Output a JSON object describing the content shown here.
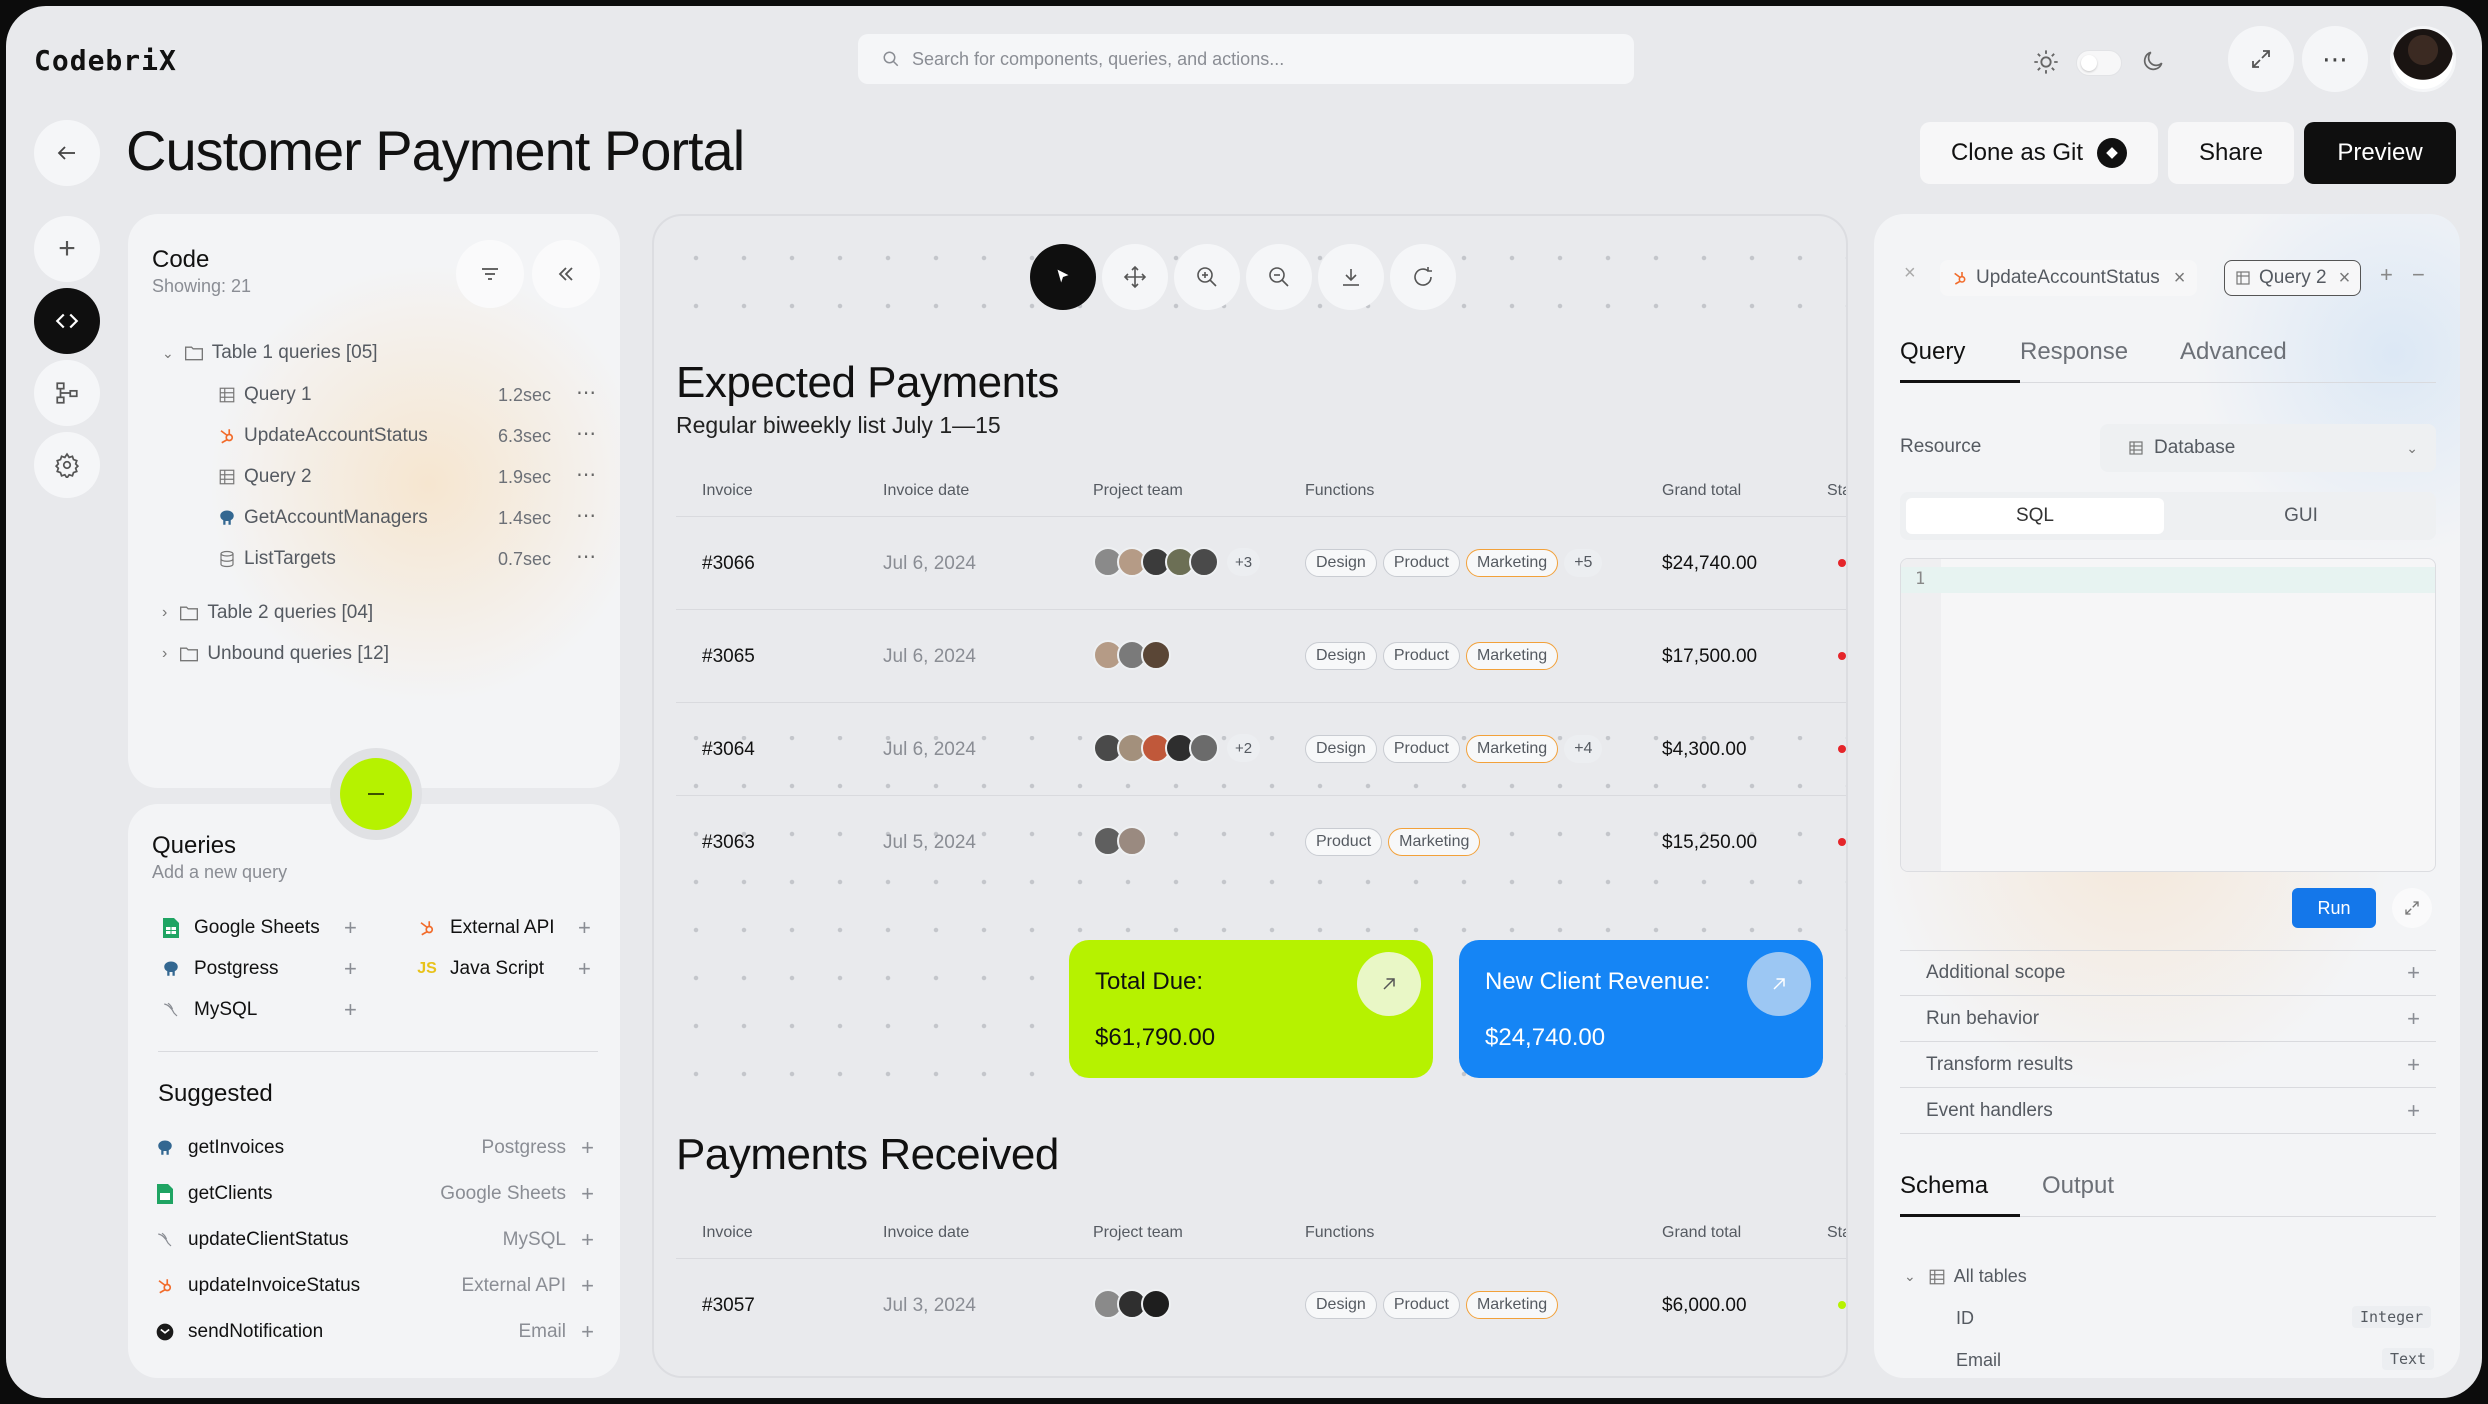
{
  "app": {
    "logo": "CodebriX"
  },
  "search": {
    "placeholder": "Search for components, queries, and actions..."
  },
  "page": {
    "title": "Customer Payment Portal"
  },
  "header_buttons": {
    "clone": "Clone as Git",
    "share": "Share",
    "preview": "Preview"
  },
  "code_panel": {
    "title": "Code",
    "subtitle": "Showing: 21",
    "groups": [
      {
        "label": "Table 1 queries [05]",
        "items": [
          {
            "name": "Query 1",
            "time": "1.2sec",
            "icon": "table-icon"
          },
          {
            "name": "UpdateAccountStatus",
            "time": "6.3sec",
            "icon": "hubspot-icon"
          },
          {
            "name": "Query 2",
            "time": "1.9sec",
            "icon": "table-icon"
          },
          {
            "name": "GetAccountManagers",
            "time": "1.4sec",
            "icon": "postgres-icon"
          },
          {
            "name": "ListTargets",
            "time": "0.7sec",
            "icon": "database-icon"
          }
        ]
      },
      {
        "label": "Table 2 queries [04]"
      },
      {
        "label": "Unbound queries [12]"
      }
    ]
  },
  "queries_panel": {
    "title": "Queries",
    "subtitle": "Add a new query",
    "sources": [
      {
        "name": "Google Sheets",
        "icon": "google-sheets-icon"
      },
      {
        "name": "External API",
        "icon": "hubspot-icon"
      },
      {
        "name": "Postgress",
        "icon": "postgres-icon"
      },
      {
        "name": "Java Script",
        "icon": "javascript-icon"
      },
      {
        "name": "MySQL",
        "icon": "mysql-icon"
      }
    ],
    "suggested_title": "Suggested",
    "suggested": [
      {
        "name": "getInvoices",
        "source": "Postgress",
        "icon": "postgres-icon"
      },
      {
        "name": "getClients",
        "source": "Google Sheets",
        "icon": "google-sheets-icon"
      },
      {
        "name": "updateClientStatus",
        "source": "MySQL",
        "icon": "mysql-icon"
      },
      {
        "name": "updateInvoiceStatus",
        "source": "External API",
        "icon": "hubspot-icon"
      },
      {
        "name": "sendNotification",
        "source": "Email",
        "icon": "email-icon"
      }
    ]
  },
  "canvas": {
    "expected": {
      "title": "Expected Payments",
      "subtitle": "Regular biweekly list July 1—15",
      "columns": [
        "Invoice",
        "Invoice date",
        "Project team",
        "Functions",
        "Grand total",
        "Sta"
      ],
      "rows": [
        {
          "invoice": "#3066",
          "date": "Jul 6, 2024",
          "team": 5,
          "team_more": "+3",
          "tags": [
            "Design",
            "Product",
            "Marketing"
          ],
          "tags_more": "+5",
          "total": "$24,740.00",
          "status_color": "#e5252a"
        },
        {
          "invoice": "#3065",
          "date": "Jul 6, 2024",
          "team": 3,
          "team_more": "",
          "tags": [
            "Design",
            "Product",
            "Marketing"
          ],
          "tags_more": "",
          "total": "$17,500.00",
          "status_color": "#e5252a"
        },
        {
          "invoice": "#3064",
          "date": "Jul 6, 2024",
          "team": 5,
          "team_more": "+2",
          "tags": [
            "Design",
            "Product",
            "Marketing"
          ],
          "tags_more": "+4",
          "total": "$4,300.00",
          "status_color": "#e5252a"
        },
        {
          "invoice": "#3063",
          "date": "Jul 5, 2024",
          "team": 2,
          "team_more": "",
          "tags": [
            "Product",
            "Marketing"
          ],
          "tags_more": "",
          "total": "$15,250.00",
          "status_color": "#e5252a"
        }
      ]
    },
    "cards": [
      {
        "label": "Total Due:",
        "value": "$61,790.00",
        "color": "#b6f200"
      },
      {
        "label": "New Client Revenue:",
        "value": "$24,740.00",
        "color": "#1585f5"
      }
    ],
    "received": {
      "title": "Payments Received",
      "columns": [
        "Invoice",
        "Invoice date",
        "Project team",
        "Functions",
        "Grand total",
        "Sta"
      ],
      "rows": [
        {
          "invoice": "#3057",
          "date": "Jul 3, 2024",
          "team": 3,
          "team_more": "",
          "tags": [
            "Design",
            "Product",
            "Marketing"
          ],
          "tags_more": "",
          "total": "$6,000.00",
          "status_color": "#b6f200"
        }
      ]
    }
  },
  "right_panel": {
    "open_tabs": [
      "UpdateAccountStatus",
      "Query 2"
    ],
    "tabs": [
      "Query",
      "Response",
      "Advanced"
    ],
    "active_tab": "Query",
    "resource_label": "Resource",
    "resource_value": "Database",
    "mode": [
      "SQL",
      "GUI"
    ],
    "line_number": "1",
    "run": "Run",
    "sections": [
      "Additional scope",
      "Run behavior",
      "Transform results",
      "Event handlers"
    ],
    "bottom_tabs": [
      "Schema",
      "Output"
    ],
    "schema_root": "All tables",
    "fields": [
      {
        "name": "ID",
        "type": "Integer"
      },
      {
        "name": "Email",
        "type": "Text"
      }
    ]
  },
  "colors": {
    "accent_lime": "#b6f200",
    "accent_blue": "#1585f5",
    "run_blue": "#1477ea"
  }
}
